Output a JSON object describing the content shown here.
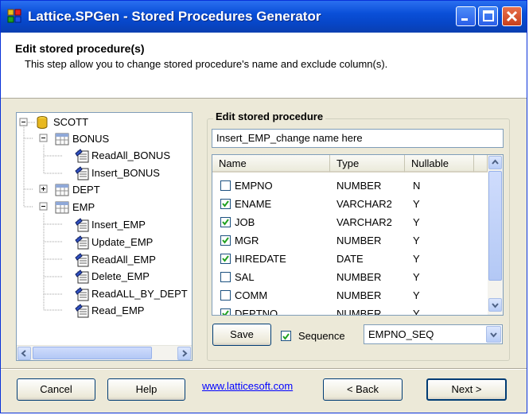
{
  "window": {
    "title": "Lattice.SPGen - Stored Procedures Generator"
  },
  "header": {
    "title": "Edit stored procedure(s)",
    "subtitle": "This step allow you to change stored procedure's name and exclude column(s)."
  },
  "tree": {
    "root": "SCOTT",
    "nodes": [
      {
        "label": "BONUS",
        "type": "table",
        "expander": "-"
      },
      {
        "label": "ReadAll_BONUS",
        "type": "proc"
      },
      {
        "label": "Insert_BONUS",
        "type": "proc"
      },
      {
        "label": "DEPT",
        "type": "table",
        "expander": "+"
      },
      {
        "label": "EMP",
        "type": "table",
        "expander": "-"
      },
      {
        "label": "Insert_EMP",
        "type": "proc"
      },
      {
        "label": "Update_EMP",
        "type": "proc"
      },
      {
        "label": "ReadAll_EMP",
        "type": "proc"
      },
      {
        "label": "Delete_EMP",
        "type": "proc"
      },
      {
        "label": "ReadALL_BY_DEPT",
        "type": "proc"
      },
      {
        "label": "Read_EMP",
        "type": "proc"
      }
    ]
  },
  "editor": {
    "group_title": "Edit stored procedure",
    "name_value": "Insert_EMP_change name here",
    "columns": [
      "Name",
      "Type",
      "Nullable"
    ],
    "rows": [
      {
        "name": "EMPNO",
        "type": "NUMBER",
        "nullable": "N",
        "checked": false
      },
      {
        "name": "ENAME",
        "type": "VARCHAR2",
        "nullable": "Y",
        "checked": true
      },
      {
        "name": "JOB",
        "type": "VARCHAR2",
        "nullable": "Y",
        "checked": true
      },
      {
        "name": "MGR",
        "type": "NUMBER",
        "nullable": "Y",
        "checked": true
      },
      {
        "name": "HIREDATE",
        "type": "DATE",
        "nullable": "Y",
        "checked": true
      },
      {
        "name": "SAL",
        "type": "NUMBER",
        "nullable": "Y",
        "checked": false
      },
      {
        "name": "COMM",
        "type": "NUMBER",
        "nullable": "Y",
        "checked": false
      },
      {
        "name": "DEPTNO",
        "type": "NUMBER",
        "nullable": "Y",
        "checked": true
      }
    ],
    "save_label": "Save",
    "sequence_label": "Sequence",
    "sequence_checked": true,
    "sequence_value": "EMPNO_SEQ"
  },
  "footer": {
    "cancel_label": "Cancel",
    "help_label": "Help",
    "link_text": "www.latticesoft.com",
    "back_label": "< Back",
    "next_label": "Next >"
  },
  "colors": {
    "title_bar": "#0a4fd8",
    "window_bg": "#ece9d8",
    "link": "#0000ff"
  }
}
